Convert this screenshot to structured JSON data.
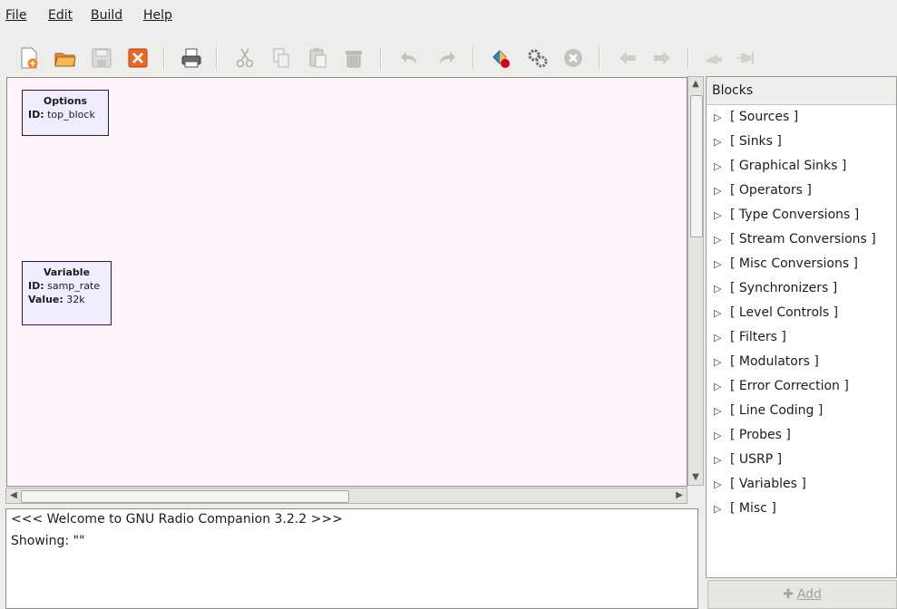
{
  "menu": {
    "file": "File",
    "edit": "Edit",
    "build": "Build",
    "help": "Help"
  },
  "toolbar": {
    "icons": [
      "new-icon",
      "open-icon",
      "save-icon",
      "close-icon",
      "print-icon",
      "cut-icon",
      "copy-icon",
      "paste-icon",
      "delete-icon",
      "undo-icon",
      "redo-icon",
      "generate-icon",
      "execute-icon",
      "kill-icon",
      "rotate-left-icon",
      "rotate-right-icon",
      "enable-icon",
      "disable-icon"
    ]
  },
  "canvas": {
    "options_block": {
      "title": "Options",
      "id_label": "ID:",
      "id_value": " top_block"
    },
    "variable_block": {
      "title": "Variable",
      "id_label": "ID:",
      "id_value": " samp_rate",
      "value_label": "Value:",
      "value_value": " 32k"
    }
  },
  "log": {
    "line1": "<<< Welcome to GNU Radio Companion 3.2.2 >>>",
    "line2": "Showing: \"\""
  },
  "blocks_panel": {
    "header": "Blocks",
    "categories": [
      "[ Sources ]",
      "[ Sinks ]",
      "[ Graphical Sinks ]",
      "[ Operators ]",
      "[ Type Conversions ]",
      "[ Stream Conversions ]",
      "[ Misc Conversions ]",
      "[ Synchronizers ]",
      "[ Level Controls ]",
      "[ Filters ]",
      "[ Modulators ]",
      "[ Error Correction ]",
      "[ Line Coding ]",
      "[ Probes ]",
      "[ USRP ]",
      "[ Variables ]",
      "[ Misc ]"
    ],
    "add_label": "Add"
  }
}
